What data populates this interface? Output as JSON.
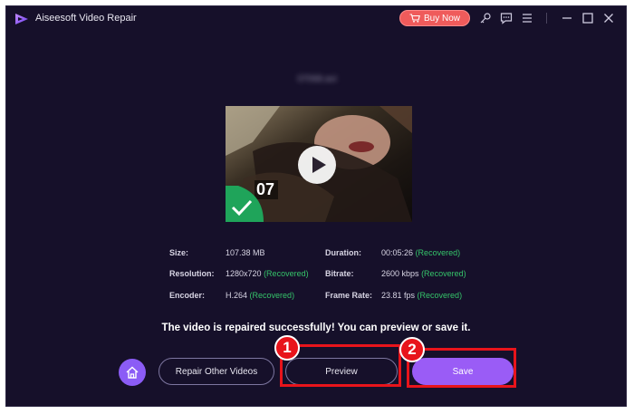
{
  "window": {
    "title": "Aiseesoft Video Repair",
    "buy_label": "Buy Now"
  },
  "file": {
    "name": "07068.avi"
  },
  "thumbnail": {
    "duration_text": "07"
  },
  "info": {
    "size_label": "Size:",
    "size_value": "107.38 MB",
    "resolution_label": "Resolution:",
    "resolution_value": "1280x720",
    "resolution_status": "(Recovered)",
    "encoder_label": "Encoder:",
    "encoder_value": "H.264",
    "encoder_status": "(Recovered)",
    "duration_label": "Duration:",
    "duration_value": "00:05:26",
    "duration_status": "(Recovered)",
    "bitrate_label": "Bitrate:",
    "bitrate_value": "2600 kbps",
    "bitrate_status": "(Recovered)",
    "framerate_label": "Frame Rate:",
    "framerate_value": "23.81 fps",
    "framerate_status": "(Recovered)"
  },
  "message": "The video is repaired successfully! You can preview or save it.",
  "actions": {
    "repair_other_label": "Repair Other Videos",
    "preview_label": "Preview",
    "save_label": "Save"
  },
  "annotations": {
    "step1": "1",
    "step2": "2",
    "color": "#e8141b"
  },
  "colors": {
    "background": "#16102a",
    "accent": "#9a5cf6",
    "recovered": "#35c46a",
    "buy": "#ef5b5b"
  }
}
